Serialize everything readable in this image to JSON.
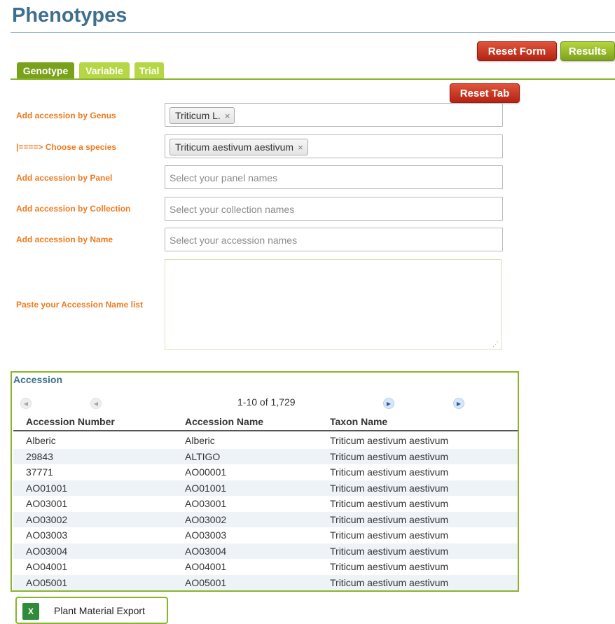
{
  "page": {
    "title": "Phenotypes"
  },
  "toolbar": {
    "reset_form": "Reset Form",
    "results": "Results",
    "reset_tab": "Reset Tab"
  },
  "tabs": [
    {
      "label": "Genotype",
      "active": true
    },
    {
      "label": "Variable",
      "active": false
    },
    {
      "label": "Trial",
      "active": false
    }
  ],
  "form": {
    "genus": {
      "label": "Add accession by Genus",
      "chip": "Triticum L.",
      "remove": "×"
    },
    "species": {
      "label": "|====> Choose a species",
      "chip": "Triticum aestivum aestivum",
      "remove": "×"
    },
    "panel": {
      "label": "Add accession by Panel",
      "placeholder": "Select your panel names"
    },
    "collection": {
      "label": "Add accession by Collection",
      "placeholder": "Select your collection names"
    },
    "name": {
      "label": "Add accession by Name",
      "placeholder": "Select your accession names"
    },
    "paste": {
      "label": "Paste your Accession Name list",
      "value": ""
    }
  },
  "accession": {
    "title": "Accession",
    "pager": "1-10 of 1,729",
    "columns": [
      "Accession Number",
      "Accession Name",
      "Taxon Name"
    ],
    "rows": [
      [
        "Alberic",
        "Alberic",
        "Triticum aestivum aestivum"
      ],
      [
        "29843",
        "ALTIGO",
        "Triticum aestivum aestivum"
      ],
      [
        "37771",
        "AO00001",
        "Triticum aestivum aestivum"
      ],
      [
        "AO01001",
        "AO01001",
        "Triticum aestivum aestivum"
      ],
      [
        "AO03001",
        "AO03001",
        "Triticum aestivum aestivum"
      ],
      [
        "AO03002",
        "AO03002",
        "Triticum aestivum aestivum"
      ],
      [
        "AO03003",
        "AO03003",
        "Triticum aestivum aestivum"
      ],
      [
        "AO03004",
        "AO03004",
        "Triticum aestivum aestivum"
      ],
      [
        "AO04001",
        "AO04001",
        "Triticum aestivum aestivum"
      ],
      [
        "AO05001",
        "AO05001",
        "Triticum aestivum aestivum"
      ]
    ]
  },
  "export": {
    "label": "Plant Material Export",
    "icon": "excel-icon",
    "icon_glyph": "X"
  },
  "icons": {
    "first": "first-page-icon",
    "prev": "previous-page-icon",
    "next": "next-page-icon",
    "last": "last-page-icon"
  },
  "colors": {
    "title": "#3f6f8e",
    "label": "#ef7b1f",
    "accent_green": "#8ab52a",
    "button_red": "#b42314"
  }
}
